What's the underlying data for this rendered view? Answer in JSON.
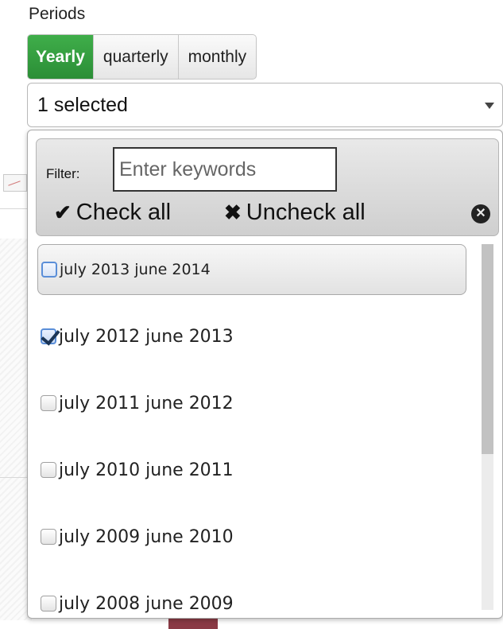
{
  "periods": {
    "label": "Periods",
    "tabs": [
      {
        "label": "Yearly",
        "active": true
      },
      {
        "label": "quarterly",
        "active": false
      },
      {
        "label": "monthly",
        "active": false
      }
    ]
  },
  "select": {
    "display": "1 selected"
  },
  "dropdown": {
    "filter_label": "Filter:",
    "filter_placeholder": "Enter keywords",
    "filter_value": "",
    "check_all": "Check all",
    "uncheck_all": "Uncheck all",
    "options": [
      {
        "label": "july 2013 june 2014",
        "checked": false,
        "hovered": true
      },
      {
        "label": "july 2012 june 2013",
        "checked": true,
        "hovered": false
      },
      {
        "label": "july 2011 june 2012",
        "checked": false,
        "hovered": false
      },
      {
        "label": "july 2010 june 2011",
        "checked": false,
        "hovered": false
      },
      {
        "label": "july 2009 june 2010",
        "checked": false,
        "hovered": false
      },
      {
        "label": "july 2008 june 2009",
        "checked": false,
        "hovered": false
      }
    ]
  },
  "icons": {
    "check": "check-icon",
    "uncheck": "x-icon",
    "close": "close-circle-icon",
    "caret": "caret-down-icon"
  },
  "colors": {
    "active_tab": "#34a040",
    "checkbox_accent": "#5a8ed8"
  }
}
